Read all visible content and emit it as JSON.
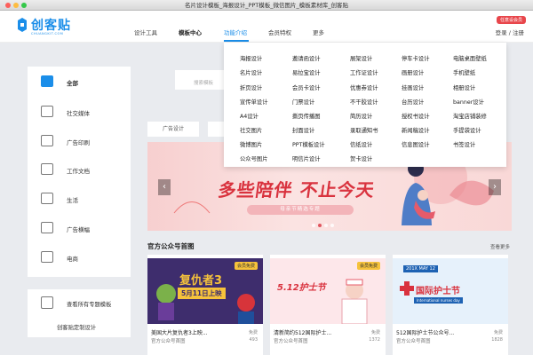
{
  "window": {
    "title": "名片设计模板_海报设计_PPT模板_微信图片_模板素材库_创客贴"
  },
  "colors": {
    "accent": "#1b8ee9",
    "brand_red": "#e8464b"
  },
  "header": {
    "logo_text": "创客贴",
    "logo_sub": "CHUANGKIT.COM",
    "nav": [
      "设计工具",
      "模板中心",
      "功能介绍",
      "会员特权",
      "更多"
    ],
    "vip_badge": "任意设会员",
    "login": "登录 / 注册"
  },
  "sidebar": {
    "items": [
      {
        "label": "全部",
        "icon": "grid-icon"
      },
      {
        "label": "社交媒体",
        "icon": "social-icon"
      },
      {
        "label": "广告印刷",
        "icon": "print-icon"
      },
      {
        "label": "工作文档",
        "icon": "document-icon"
      },
      {
        "label": "生活",
        "icon": "life-icon"
      },
      {
        "label": "广告横幅",
        "icon": "banner-icon"
      },
      {
        "label": "电商",
        "icon": "shop-icon"
      }
    ],
    "footer_link": "查看所有专题模板",
    "footer_text": "创客贴定制设计"
  },
  "search": {
    "placeholder": "搜索模板"
  },
  "chips": [
    "广告设计"
  ],
  "dropdown": {
    "columns": [
      [
        "海报设计",
        "名片设计",
        "折页设计",
        "宣传单设计",
        "A4设计",
        "社交图片",
        "微博图片",
        "公众号图片"
      ],
      [
        "邀请函设计",
        "易拉宝设计",
        "会员卡设计",
        "门票设计",
        "撕页传播图",
        "封面设计",
        "PPT模板设计",
        "明信片设计"
      ],
      [
        "展架设计",
        "工作证设计",
        "优惠券设计",
        "不干胶设计",
        "简历设计",
        "录取通知书",
        "信纸设计",
        "贺卡设计"
      ],
      [
        "停车卡设计",
        "画册设计",
        "挂画设计",
        "台历设计",
        "授权书设计",
        "新闻稿设计",
        "信息图设计"
      ],
      [
        "电脑桌面壁纸",
        "手机壁纸",
        "相册设计",
        "banner设计",
        "淘宝店铺装修",
        "手提袋设计",
        "书签设计"
      ]
    ]
  },
  "banner": {
    "headline": "多些陪伴 不止今天",
    "subline": "母亲节精选专题"
  },
  "section": {
    "title": "官方公众号首图",
    "more": "查看更多"
  },
  "cards": [
    {
      "title": "美国大片复仇者3上映...",
      "sub": "官方公众号首图",
      "free": "免费",
      "views": "493",
      "img_title": "复仇者3",
      "img_sub": "5月11日上映",
      "img_tag": "会员免费"
    },
    {
      "title": "清新简约512国际护士...",
      "sub": "官方公众号首图",
      "free": "免费",
      "views": "1372",
      "img_title": "5.12护士节",
      "img_sub": "",
      "img_tag": "会员免费"
    },
    {
      "title": "512国际护士节公众号...",
      "sub": "官方公众号首图",
      "free": "免费",
      "views": "1828",
      "img_title": "国际护士节",
      "img_sub": "International nurses day",
      "img_tag": "201X  MAY  12"
    }
  ]
}
